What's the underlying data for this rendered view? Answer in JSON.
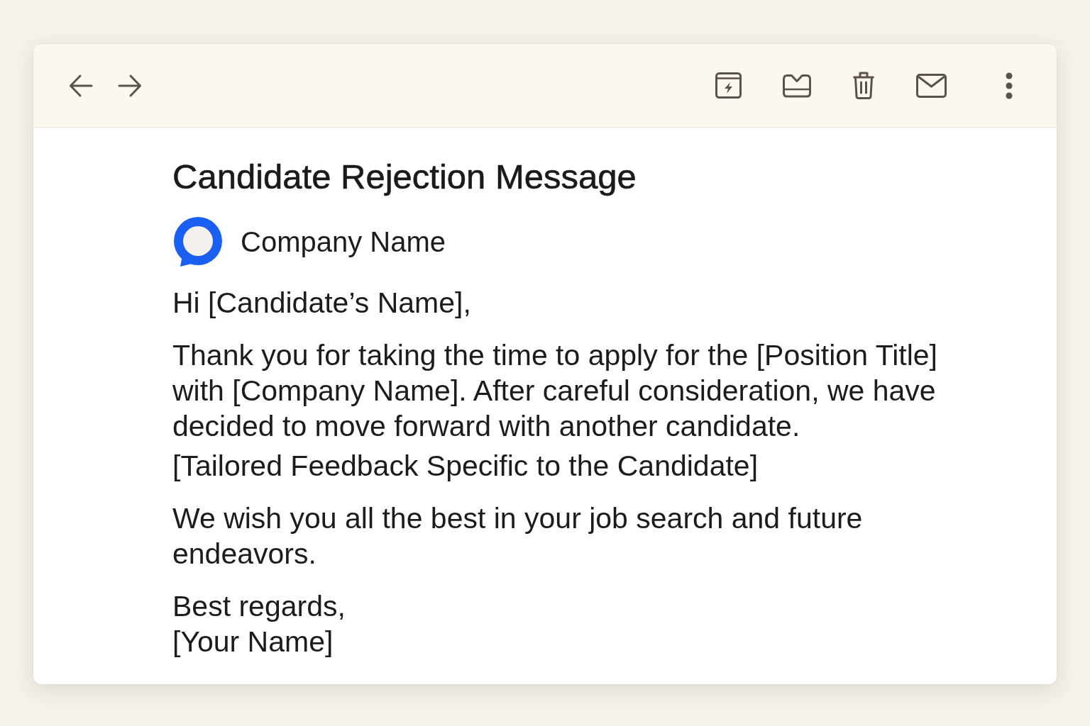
{
  "message": {
    "subject": "Candidate Rejection Message",
    "sender": "Company Name",
    "greeting": "Hi [Candidate’s Name],",
    "paragraphs": [
      [
        "Thank you for taking the time to apply for the [Position Title] with [Company Name]. After careful consideration, we have decided to move forward with another candidate.",
        "[Tailored Feedback Specific to the Candidate]"
      ],
      [
        "We wish you all the best in your job search and future endeavors."
      ]
    ],
    "sign_off": [
      "Best regards,",
      "[Your Name]"
    ]
  }
}
